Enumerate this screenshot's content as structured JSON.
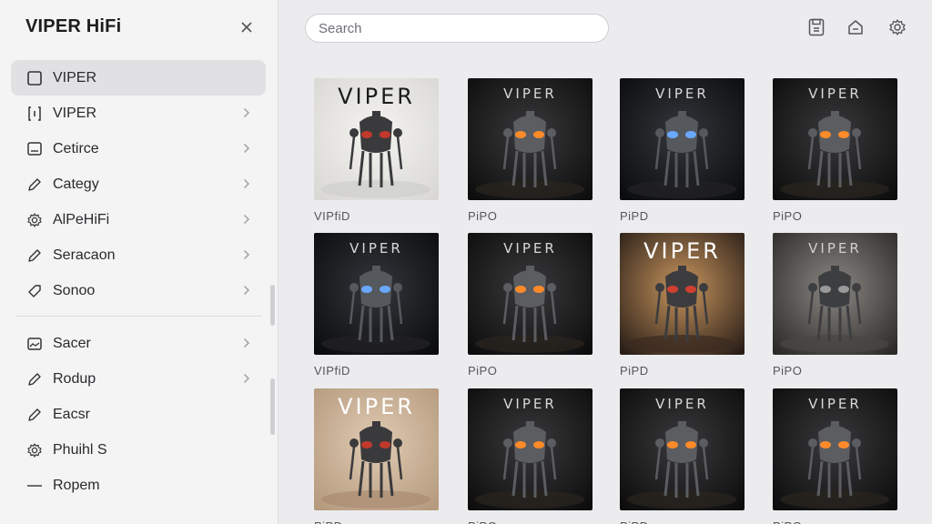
{
  "app": {
    "title": "VIPER HiFi"
  },
  "search": {
    "placeholder": "Search"
  },
  "sidebar": {
    "items": [
      {
        "label": "VIPER",
        "icon": "square-icon",
        "chevron": false,
        "active": true
      },
      {
        "label": "VIPER",
        "icon": "bracket-icon",
        "chevron": true
      },
      {
        "label": "Cetirce",
        "icon": "monitor-icon",
        "chevron": true
      },
      {
        "label": "Categy",
        "icon": "pencil-icon",
        "chevron": true
      },
      {
        "label": "AlPeHiFi",
        "icon": "gear-icon",
        "chevron": true
      },
      {
        "label": "Seracaon",
        "icon": "pencil-icon",
        "chevron": true
      },
      {
        "label": "Sonoo",
        "icon": "tag-icon",
        "chevron": true
      }
    ],
    "items2": [
      {
        "label": "Sacer",
        "icon": "image-icon",
        "chevron": true
      },
      {
        "label": "Rodup",
        "icon": "pencil-icon",
        "chevron": true
      },
      {
        "label": "Eacsr",
        "icon": "pencil-icon",
        "chevron": false
      },
      {
        "label": "Phuihl S",
        "icon": "gear-icon",
        "chevron": false
      },
      {
        "label": "Ropem",
        "icon": "dash-icon",
        "chevron": false
      }
    ]
  },
  "toolbar": {
    "icons": [
      "save-icon",
      "home-icon",
      "gear-icon"
    ]
  },
  "albums": [
    {
      "caption": "VIPfiD",
      "title": "VIPER",
      "style": "light"
    },
    {
      "caption": "PiPO",
      "title": "VIPER",
      "style": "dark-orange"
    },
    {
      "caption": "PiPD",
      "title": "VIPER",
      "style": "dark-blue"
    },
    {
      "caption": "PiPO",
      "title": "VIPER",
      "style": "dark-orange"
    },
    {
      "caption": "VIPfiD",
      "title": "VIPER",
      "style": "dark-blue"
    },
    {
      "caption": "PiPO",
      "title": "VIPER",
      "style": "dark-orange"
    },
    {
      "caption": "PiPD",
      "title": "VIPER",
      "style": "desert"
    },
    {
      "caption": "PiPO",
      "title": "VIPER",
      "style": "canyon"
    },
    {
      "caption": "PiPD",
      "title": "VIPER",
      "style": "tan"
    },
    {
      "caption": "PiPO",
      "title": "VIPER",
      "style": "dark-orange"
    },
    {
      "caption": "PiPD",
      "title": "VIPER",
      "style": "dark-orange"
    },
    {
      "caption": "PiPO",
      "title": "VIPER",
      "style": "dark-orange"
    }
  ]
}
